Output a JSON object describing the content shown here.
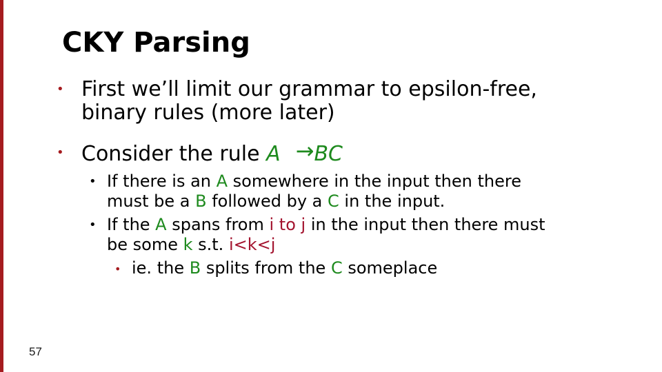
{
  "slide": {
    "title": "CKY Parsing",
    "bullets": [
      {
        "line1": "First we’ll limit our grammar to epsilon-free,",
        "line2": "binary rules (more later)"
      },
      {
        "text": "Consider the rule ",
        "lhs": "A",
        "arrow": "→",
        "rhs": "BC"
      }
    ],
    "sub_bullets": [
      {
        "p1": "If there is an ",
        "a": "A",
        "p2": " somewhere in the input then there",
        "p3": "must be a ",
        "b": "B",
        "p4": " followed by a ",
        "c": "C",
        "p5": " in the input."
      },
      {
        "p1": "If the ",
        "a": "A",
        "p2": " spans from ",
        "span": "i to j",
        "p3": " in the input then there must",
        "p4": "be some ",
        "k": "k",
        "p5": " s.t. ",
        "cond": "i<k<j"
      }
    ],
    "sub_sub_bullet": {
      "p1": "ie. the ",
      "b": "B",
      "p2": " splits from the ",
      "c": "C",
      "p3": " someplace"
    },
    "slide_number": "57"
  },
  "colors": {
    "accent_bar": "#a51b1f",
    "bullet_red": "#a51b1f",
    "green": "#1e8a1e",
    "red_text": "#a3132e"
  },
  "icons": {
    "bullet": "bullet-dot-icon"
  }
}
